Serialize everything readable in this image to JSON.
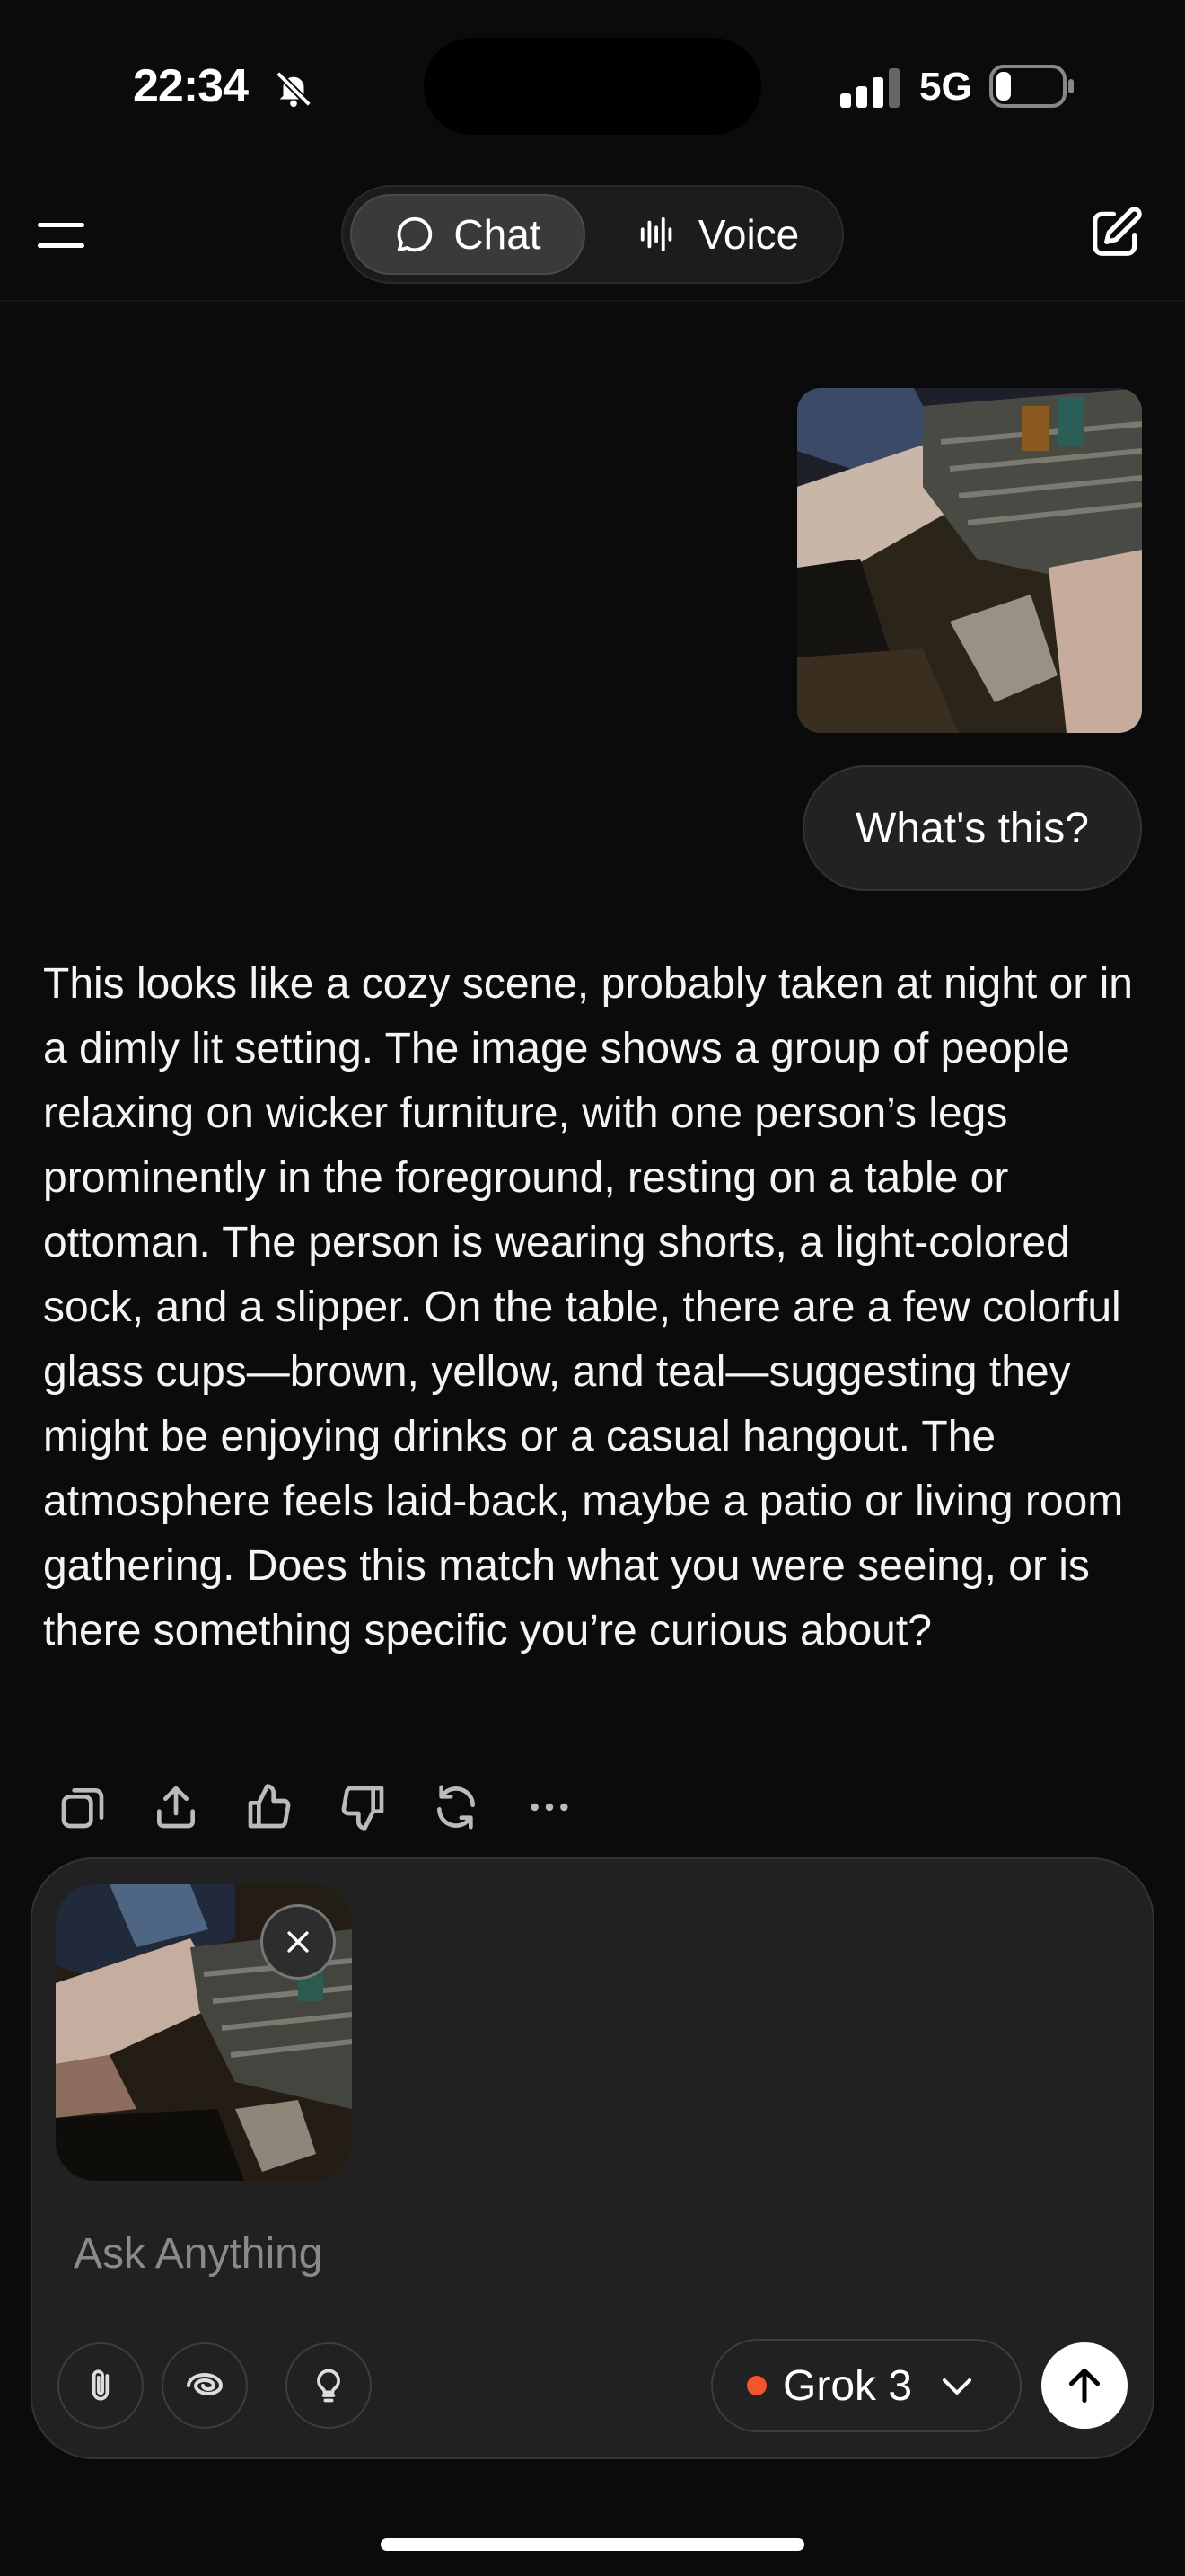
{
  "status_bar": {
    "time": "22:34",
    "network": "5G"
  },
  "header": {
    "tabs": [
      {
        "label": "Chat",
        "icon": "chat-bubble-icon"
      },
      {
        "label": "Voice",
        "icon": "waveform-icon"
      }
    ]
  },
  "conversation": {
    "user_message": "What's this?",
    "assistant_response": "This looks like a cozy scene, probably taken at night or in a dimly lit setting. The image shows a group of people relaxing on wicker furniture, with one person’s legs prominently in the foreground, resting on a table or ottoman. The person is wearing shorts, a light-colored sock, and a slipper. On the table, there are a few colorful glass cups—brown, yellow, and teal—suggesting they might be enjoying drinks or a casual hangout. The atmosphere feels laid-back, maybe a patio or living room gathering. Does this match what you were seeing, or is there something specific you’re curious about?",
    "actions": [
      "copy-icon",
      "share-icon",
      "thumbs-up-icon",
      "thumbs-down-icon",
      "regenerate-icon",
      "more-icon"
    ]
  },
  "composer": {
    "placeholder": "Ask Anything",
    "model": "Grok 3",
    "model_dot_color": "#f2542d"
  }
}
